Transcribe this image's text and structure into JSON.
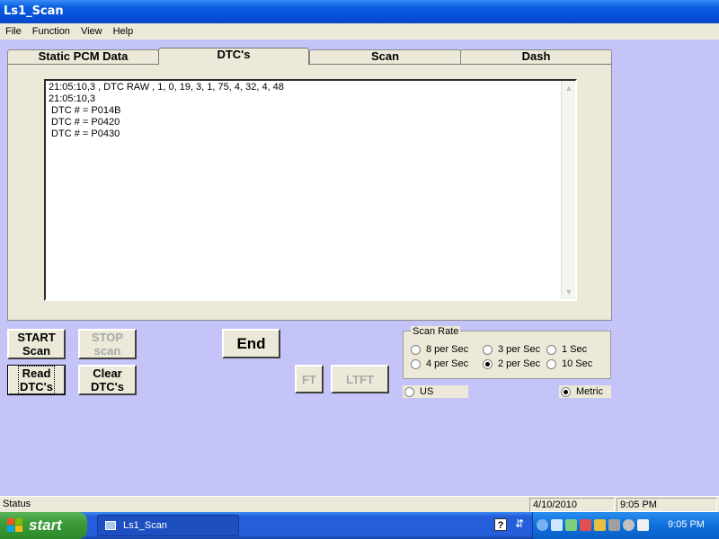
{
  "window": {
    "title": "Ls1_Scan"
  },
  "menu": [
    "File",
    "Function",
    "View",
    "Help"
  ],
  "tabs": [
    {
      "label": "Static PCM Data",
      "active": false
    },
    {
      "label": "DTC's",
      "active": true
    },
    {
      "label": "Scan",
      "active": false
    },
    {
      "label": "Dash",
      "active": false
    }
  ],
  "output_lines": [
    "21:05:10,3 , DTC RAW , 1, 0, 19, 3, 1, 75, 4, 32, 4, 48",
    "21:05:10,3",
    " DTC # = P014B",
    " DTC # = P0420",
    " DTC # = P0430"
  ],
  "buttons": {
    "start_scan": "START\nScan",
    "stop_scan": "STOP\nscan",
    "end": "End",
    "read_dtcs": "Read\nDTC's",
    "clear_dtcs": "Clear\nDTC's",
    "ft": "FT",
    "ltft": "LTFT"
  },
  "scan_rate": {
    "legend": "Scan Rate",
    "options": [
      {
        "label": "8 per Sec",
        "checked": false
      },
      {
        "label": "3 per Sec",
        "checked": false
      },
      {
        "label": "1 Sec",
        "checked": false
      },
      {
        "label": "4 per Sec",
        "checked": false
      },
      {
        "label": "2 per Sec",
        "checked": true
      },
      {
        "label": "10  Sec",
        "checked": false
      }
    ]
  },
  "units": [
    {
      "label": "US",
      "checked": false
    },
    {
      "label": "Metric",
      "checked": true
    }
  ],
  "status": {
    "text": "Status",
    "date": "4/10/2010",
    "time": "9:05 PM"
  },
  "taskbar": {
    "start_label": "start",
    "task_label": "Ls1_Scan",
    "clock": "9:05 PM"
  },
  "colors": {
    "background": "#c4c4f8",
    "control": "#ece9d8",
    "titlebar": "#0550d8",
    "start_green": "#3c9c37"
  }
}
